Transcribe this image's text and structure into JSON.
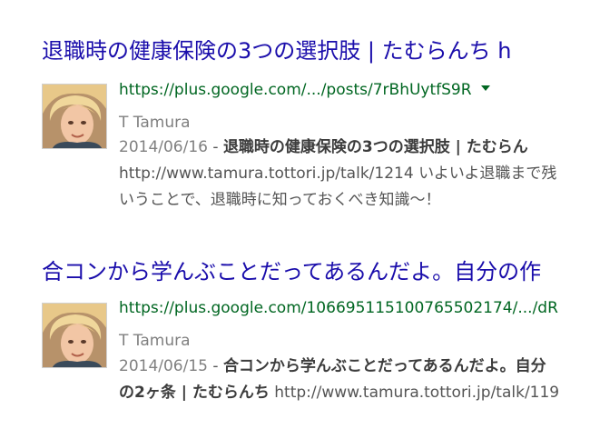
{
  "results": [
    {
      "title": "退職時の健康保険の3つの選択肢 | たむらんち h",
      "url": "https://plus.google.com/.../posts/7rBhUytfS9R",
      "has_menu_caret": true,
      "author": "T Tamura",
      "date": "2014/06/16",
      "separator": " - ",
      "snippet_bold": "退職時の健康保険の3つの選択肢 | たむらん",
      "snippet_line2": "http://www.tamura.tottori.jp/talk/1214 いよいよ退職まで残",
      "snippet_line3": "いうことで、退職時に知っておくべき知識～！"
    },
    {
      "title": "合コンから学んぶことだってあるんだよ。自分の作",
      "url": "https://plus.google.com/106695115100765502174/.../dR",
      "has_menu_caret": false,
      "author": "T Tamura",
      "date": "2014/06/15",
      "separator": " - ",
      "snippet_bold": "合コンから学んぶことだってあるんだよ。自分",
      "snippet_line2_bold": "の2ヶ条 | たむらんち",
      "snippet_line2_rest": " http://www.tamura.tottori.jp/talk/119"
    }
  ],
  "colors": {
    "title_link": "#1a0dab",
    "url": "#006621",
    "meta_gray": "#808080",
    "snippet": "#545454"
  },
  "icons": [
    "caret-down-icon",
    "author-avatar"
  ]
}
